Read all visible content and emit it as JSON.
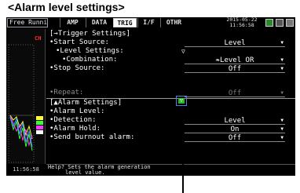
{
  "caption": "<Alarm level settings>",
  "topbar": {
    "status": "Free Running",
    "tabs": [
      "AMP",
      "DATA",
      "TRIG",
      "I/F",
      "OTHR"
    ],
    "active_tab": "TRIG",
    "date": "2015-05-22",
    "time": "11:56:58"
  },
  "graph": {
    "channel_label": "CH",
    "time": "11:56:58",
    "marker_colors": [
      "#ffff33",
      "#33ff33",
      "#ff33ff",
      "#ffffff"
    ]
  },
  "trigger": {
    "header": "[→Trigger Settings]",
    "start_source_label": "•Start Source:",
    "start_source_value": "Level",
    "level_settings_label": "•Level Settings:",
    "combination_label": "•Combination:",
    "combination_value": "❧Level OR",
    "stop_source_label": "•Stop Source:",
    "stop_source_value": "Off",
    "repeat_label": "•Repeat:",
    "repeat_value": "Off"
  },
  "alarm": {
    "header": "[▲Alarm Settings]",
    "alarm_level_label": "•Alarm Level:",
    "detection_label": "•Detection:",
    "detection_value": "Level",
    "alarm_hold_label": "•Alarm Hold:",
    "alarm_hold_value": "On",
    "burnout_label": "•Send burnout alarm:",
    "burnout_value": "Off"
  },
  "help": {
    "line1": "Help? Sets the alarm generation",
    "line2": "level value."
  },
  "colors": {
    "accent_green": "#22bb22",
    "focus_blue": "#4a7ee0",
    "channel_red": "#ff3030"
  }
}
